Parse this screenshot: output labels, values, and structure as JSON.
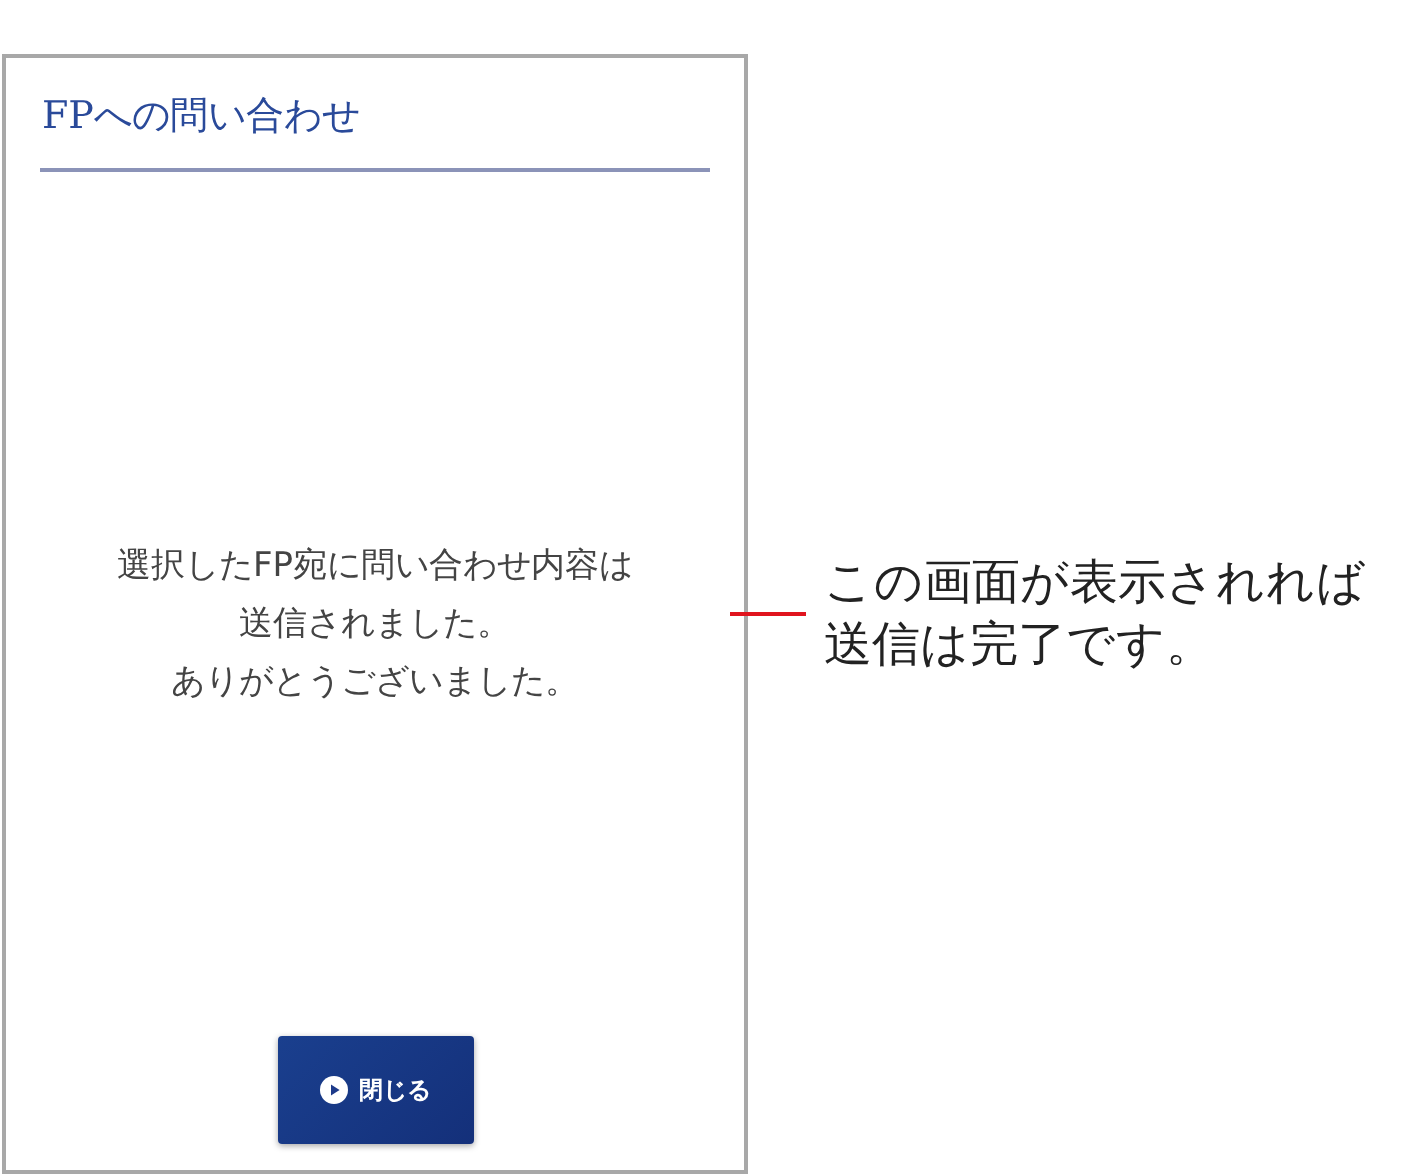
{
  "screen": {
    "title": "FPへの問い合わせ",
    "message_lines": [
      "選択したFP宛に問い合わせ内容は",
      "送信されました。",
      "ありがとうございました。"
    ],
    "close_button": {
      "label": "閉じる"
    }
  },
  "annotation": {
    "lines": [
      "この画面が表示されれば",
      "送信は完了です。"
    ]
  }
}
